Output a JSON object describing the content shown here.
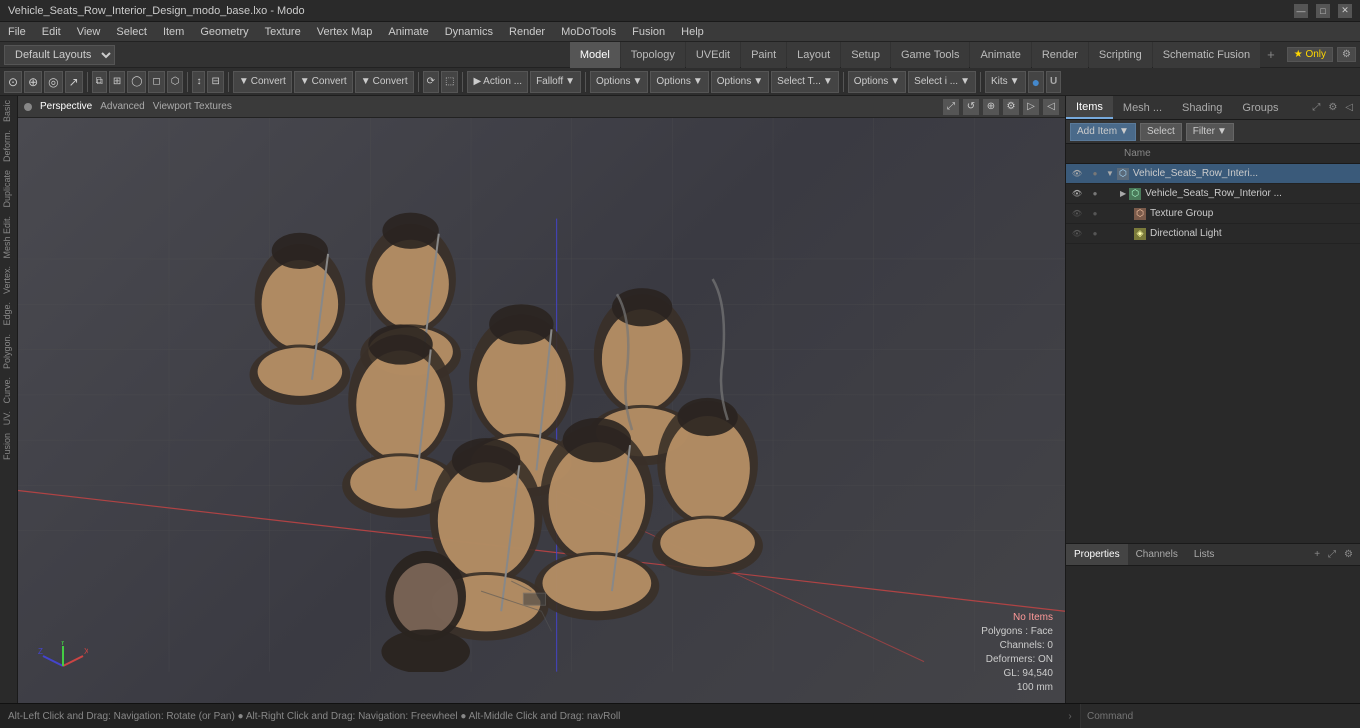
{
  "titlebar": {
    "title": "Vehicle_Seats_Row_Interior_Design_modo_base.lxo - Modo",
    "minimize": "—",
    "maximize": "□",
    "close": "✕"
  },
  "menubar": {
    "items": [
      "File",
      "Edit",
      "View",
      "Select",
      "Item",
      "Geometry",
      "Texture",
      "Vertex Map",
      "Animate",
      "Dynamics",
      "Render",
      "MoDoTools",
      "Fusion",
      "Help"
    ]
  },
  "layoutsbar": {
    "dropdown": "Default Layouts ▾",
    "tabs": [
      {
        "label": "Model",
        "active": true
      },
      {
        "label": "Topology",
        "active": false
      },
      {
        "label": "UVEdit",
        "active": false
      },
      {
        "label": "Paint",
        "active": false
      },
      {
        "label": "Layout",
        "active": false
      },
      {
        "label": "Setup",
        "active": false
      },
      {
        "label": "Game Tools",
        "active": false
      },
      {
        "label": "Animate",
        "active": false
      },
      {
        "label": "Render",
        "active": false
      },
      {
        "label": "Scripting",
        "active": false
      },
      {
        "label": "Schematic Fusion",
        "active": false
      }
    ],
    "plus": "+",
    "star_only": "★  Only",
    "gear": "⚙"
  },
  "toolbar": {
    "tools": [
      {
        "label": "",
        "icon": "⊙",
        "type": "icon"
      },
      {
        "label": "",
        "icon": "⊕",
        "type": "icon"
      },
      {
        "label": "",
        "icon": "◎",
        "type": "icon"
      },
      {
        "label": "",
        "icon": "↗",
        "type": "icon"
      },
      {
        "label": "",
        "icon": "⧉",
        "type": "icon"
      },
      {
        "label": "",
        "icon": "⊞",
        "type": "icon"
      },
      {
        "label": "",
        "icon": "◯",
        "type": "icon"
      },
      {
        "label": "",
        "icon": "◻",
        "type": "icon"
      },
      {
        "label": "",
        "icon": "⬡",
        "type": "icon"
      },
      {
        "label": "sep"
      },
      {
        "label": "",
        "icon": "↘",
        "type": "icon"
      },
      {
        "label": "",
        "icon": "⊟",
        "type": "icon"
      },
      {
        "label": "sep"
      },
      {
        "label": "Convert",
        "icon": "▼",
        "type": "btn"
      },
      {
        "label": "Convert",
        "icon": "▼",
        "type": "btn"
      },
      {
        "label": "Convert",
        "icon": "▼",
        "type": "btn"
      },
      {
        "label": "sep"
      },
      {
        "label": "",
        "icon": "⟳",
        "type": "icon"
      },
      {
        "label": "",
        "icon": "⬚",
        "type": "icon"
      },
      {
        "label": "sep"
      },
      {
        "label": "Action ...",
        "icon": "▶",
        "type": "btn"
      },
      {
        "label": "Falloff",
        "icon": "▼",
        "type": "btn"
      },
      {
        "label": "sep"
      },
      {
        "label": "Options",
        "icon": "▼",
        "type": "btn"
      },
      {
        "label": "Options",
        "icon": "▼",
        "type": "btn"
      },
      {
        "label": "Options",
        "icon": "▼",
        "type": "btn"
      },
      {
        "label": "Select T...",
        "icon": "▼",
        "type": "btn"
      },
      {
        "label": "sep"
      },
      {
        "label": "Options",
        "icon": "▼",
        "type": "btn"
      },
      {
        "label": "Select i ...",
        "icon": "▼",
        "type": "btn"
      },
      {
        "label": "sep"
      },
      {
        "label": "Kits",
        "icon": "▼",
        "type": "btn"
      },
      {
        "label": "",
        "icon": "🔵",
        "type": "icon"
      },
      {
        "label": "",
        "icon": "U",
        "type": "icon"
      }
    ]
  },
  "viewport": {
    "dot_color": "#666",
    "tabs": [
      "Perspective",
      "Advanced",
      "Viewport Textures"
    ],
    "active_tab": "Perspective",
    "info": {
      "no_items": "No Items",
      "polygons": "Polygons : Face",
      "channels": "Channels: 0",
      "deformers": "Deformers: ON",
      "gl": "GL: 94,540",
      "distance": "100 mm"
    }
  },
  "left_sidebar": {
    "labels": [
      "Basic",
      "Deform.",
      "Duplicate",
      "Mesh Edit.",
      "Vertex.",
      "Edge.",
      "Polygon.",
      "Curve.",
      "UV.",
      "Fusion"
    ]
  },
  "right_panel": {
    "tabs": [
      "Items",
      "Mesh ...",
      "Shading",
      "Groups"
    ],
    "active_tab": "Items",
    "items_toolbar": {
      "add_item": "Add Item",
      "add_item_arrow": "▼",
      "select": "Select",
      "filter": "Filter",
      "filter_arrow": "▼"
    },
    "items_list_header": {
      "name_col": "Name"
    },
    "items": [
      {
        "id": 1,
        "indent": 0,
        "has_arrow": true,
        "arrow": "▼",
        "icon": "📁",
        "icon_type": "group",
        "name": "Vehicle_Seats_Row_Interi...",
        "eye": true,
        "selected": true
      },
      {
        "id": 2,
        "indent": 1,
        "has_arrow": true,
        "arrow": "▶",
        "icon": "🔷",
        "icon_type": "mesh",
        "name": "Vehicle_Seats_Row_Interior ...",
        "eye": true
      },
      {
        "id": 3,
        "indent": 2,
        "has_arrow": false,
        "arrow": "",
        "icon": "🔶",
        "icon_type": "texture",
        "name": "Texture Group",
        "eye": false
      },
      {
        "id": 4,
        "indent": 2,
        "has_arrow": false,
        "arrow": "",
        "icon": "💡",
        "icon_type": "light",
        "name": "Directional Light",
        "eye": false
      }
    ]
  },
  "properties": {
    "tabs": [
      "Properties",
      "Channels",
      "Lists"
    ],
    "active_tab": "Properties",
    "plus": "+"
  },
  "statusbar": {
    "left_text": "Alt-Left Click and Drag: Navigation: Rotate (or Pan)  ●  Alt-Right Click and Drag: Navigation: Freewheel  ●  Alt-Middle Click and Drag: navRoll",
    "arrow": "›",
    "command_placeholder": "Command"
  }
}
